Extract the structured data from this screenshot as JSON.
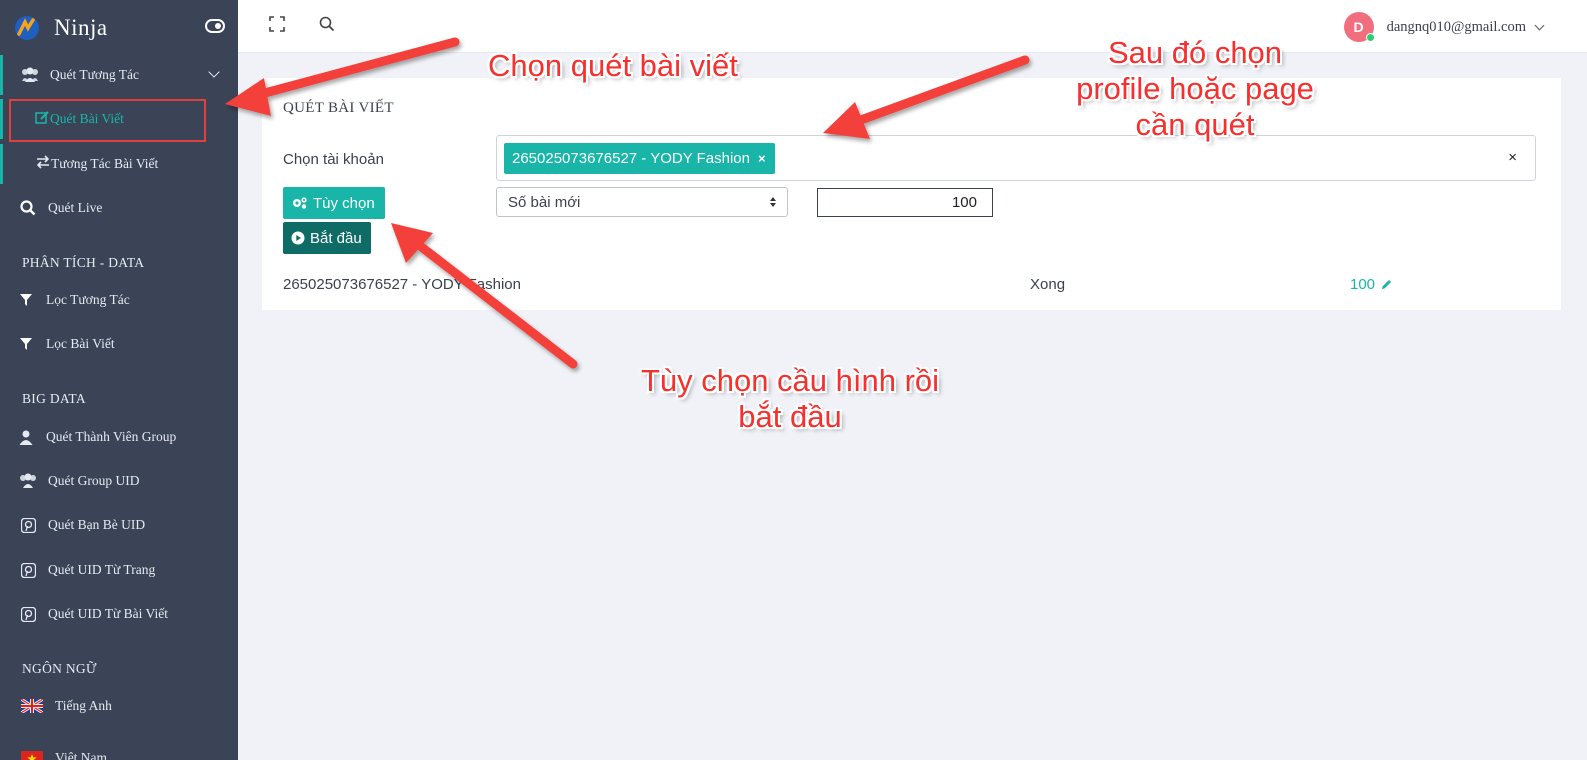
{
  "brand": {
    "name": "Ninja"
  },
  "sidebar": {
    "group_scan_interaction": "Quét Tương Tác",
    "sub_items": [
      "Quét Bài Viết",
      "Tương Tác Bài Viết"
    ],
    "scan_live": "Quét Live",
    "section_analysis": "PHÂN TÍCH - DATA",
    "analysis_items": [
      "Lọc Tương Tác",
      "Lọc Bài Viết"
    ],
    "section_bigdata": "BIG DATA",
    "bigdata_items": [
      "Quét Thành Viên Group",
      "Quét Group UID",
      "Quét Bạn Bè UID",
      "Quét UID Từ Trang",
      "Quét UID Từ Bài Viết"
    ],
    "section_language": "NGÔN NGỮ",
    "language_items": [
      "Tiếng Anh",
      "Việt Nam"
    ]
  },
  "topbar": {
    "avatar_letter": "D",
    "user_email": "dangnq010@gmail.com"
  },
  "card": {
    "title": "QUÉT BÀI VIẾT",
    "account_label": "Chọn tài khoản",
    "selected_account": "265025073676527 - YODY Fashion",
    "chip_remove": "×",
    "clear_all": "×",
    "options_button": "Tùy chọn",
    "start_button": "Bắt đầu",
    "post_type_selected": "Số bài mới",
    "post_count_value": "100",
    "result_row": {
      "account": "265025073676527 - YODY Fashion",
      "status": "Xong",
      "count": "100"
    }
  },
  "annotations": {
    "step1": "Chọn quét bài viết",
    "step2_line1": "Sau đó chọn",
    "step2_line2": "profile hoặc page",
    "step2_line3": "cần quét",
    "step3_line1": "Tùy chọn cầu hình rồi",
    "step3_line2": "bắt đầu"
  },
  "colors": {
    "sidebar_bg": "#3a4456",
    "accent_teal": "#19b5a8",
    "dark_teal": "#0e6b66",
    "annotation_red": "#f5302e",
    "avatar_pink": "#f06e7e"
  }
}
